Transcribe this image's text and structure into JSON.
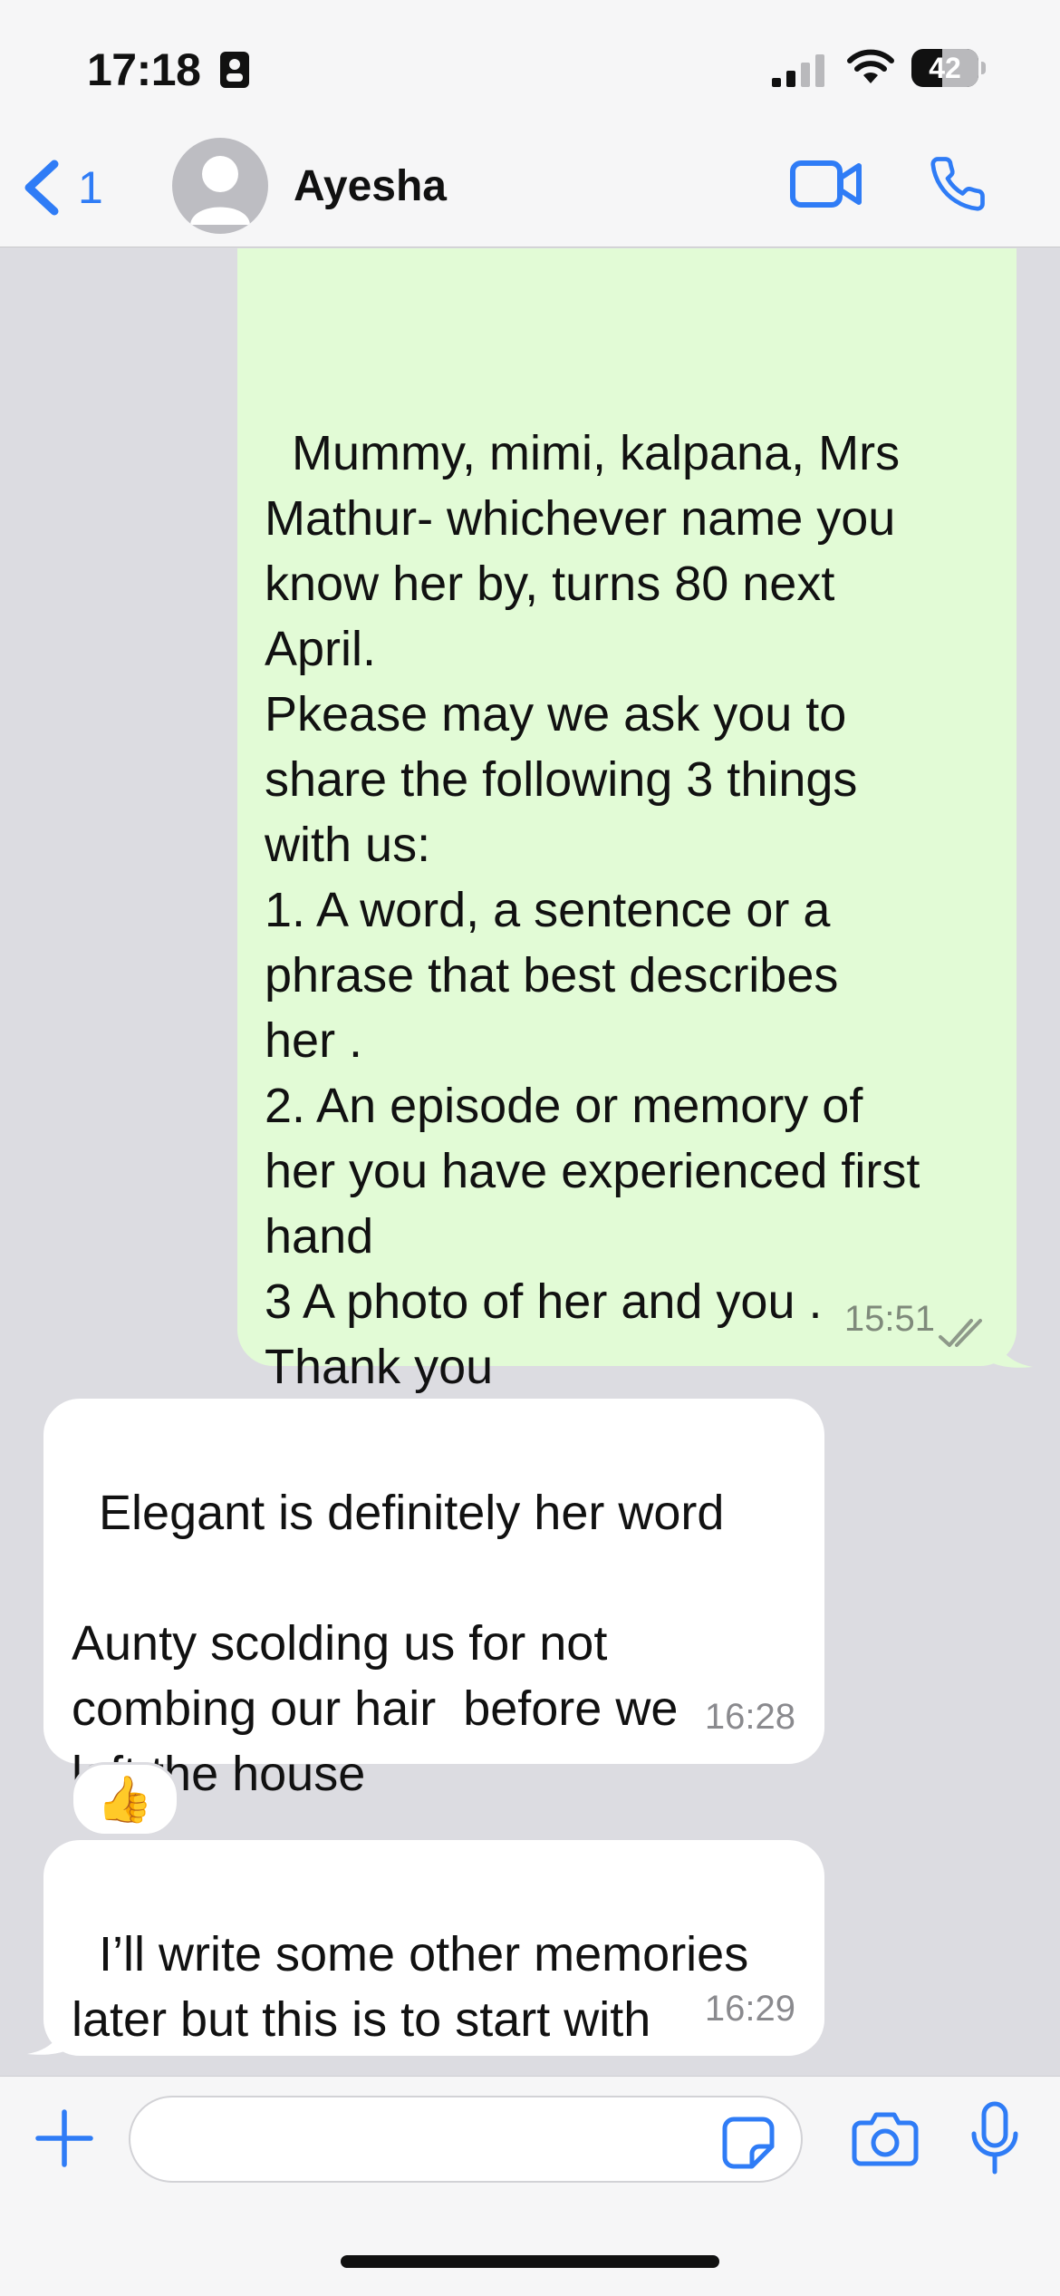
{
  "status_bar": {
    "time": "17:18",
    "battery": "42",
    "icons": [
      "id-badge-icon",
      "signal-icon",
      "wifi-icon",
      "battery-icon"
    ]
  },
  "header": {
    "back_count": "1",
    "contact_name": "Ayesha",
    "icons": [
      "chevron-left-icon",
      "avatar-icon",
      "video-icon",
      "phone-icon"
    ]
  },
  "messages": [
    {
      "direction": "outgoing",
      "text": "Mummy, mimi, kalpana, Mrs\nMathur- whichever name you\nknow her by, turns 80 next\nApril.\nPkease may we ask you to\nshare the following 3 things\nwith us:\n1. A word, a sentence or a\nphrase that best describes\nher .\n2. An episode or memory of\nher you have experienced first\nhand\n3 A photo of her and you .\nThank you",
      "time": "15:51",
      "status_icon": "double-check-icon"
    },
    {
      "direction": "incoming",
      "text": "Elegant is definitely her word\n\nAunty scolding us for not\ncombing our hair  before we\nleft the house",
      "time": "16:28",
      "reaction": "👍"
    },
    {
      "direction": "incoming",
      "text": "I’ll write some other memories\nlater but this is to start with",
      "time": "16:29"
    }
  ],
  "composer": {
    "input_value": "",
    "icons": [
      "plus-icon",
      "sticker-icon",
      "camera-icon",
      "microphone-icon"
    ]
  },
  "colors": {
    "accent": "#2f7cf6",
    "outgoing_bubble": "#e2fbd6",
    "incoming_bubble": "#ffffff",
    "chat_background": "#dcdce1"
  }
}
